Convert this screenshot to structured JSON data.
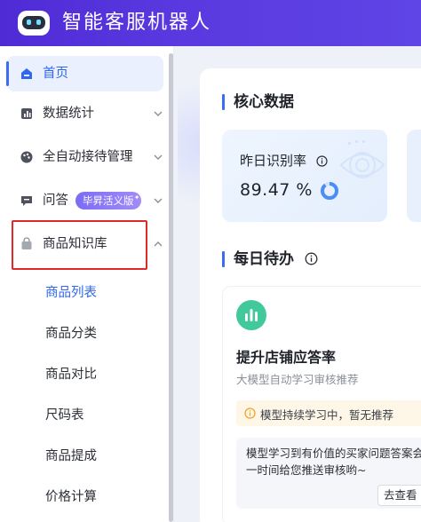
{
  "app": {
    "title": "智能客服机器人"
  },
  "sidebar": {
    "items": [
      {
        "label": "首页",
        "icon": "home-icon",
        "active": true
      },
      {
        "label": "数据统计",
        "icon": "chart-bar-icon"
      },
      {
        "label": "全自动接待管理",
        "icon": "palette-icon"
      },
      {
        "label": "问答",
        "icon": "chat-icon",
        "badge": "毕昇活义版"
      },
      {
        "label": "商品知识库",
        "icon": "shopping-bag-icon",
        "expanded": true
      }
    ],
    "sub_items": [
      "商品列表",
      "商品分类",
      "商品对比",
      "尺码表",
      "商品提成",
      "价格计算"
    ],
    "badge_star": "✦"
  },
  "main": {
    "core_section_title": "核心数据",
    "stat": {
      "label": "昨日识别率",
      "value": "89.47 %",
      "ratio": 0.8947
    },
    "daily_section_title": "每日待办",
    "todo": {
      "title": "提升店铺应答率",
      "desc": "大模型自动学习审核推荐",
      "notice": "模型持续学习中，暂无推荐",
      "message_line1": "模型学习到有价值的买家问题答案会",
      "message_line2": "一时间给您推送审核哟~",
      "button": "去查看"
    }
  },
  "colors": {
    "primary": "#3a6cf4",
    "header": "#5a3ae0",
    "highlight": "#e02a2a",
    "badge": "#8f7bf7"
  }
}
